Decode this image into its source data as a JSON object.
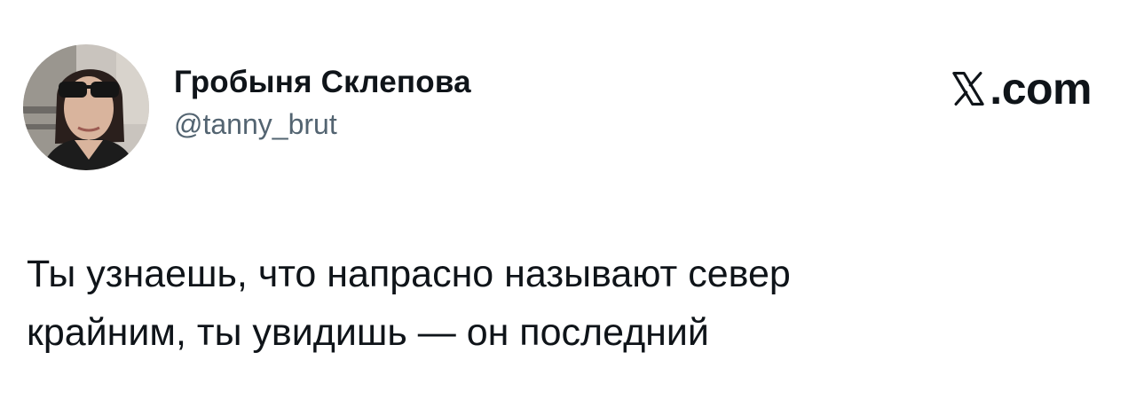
{
  "author": {
    "display_name": "Гробыня Склепова",
    "handle": "@tanny_brut",
    "avatar_icon": "profile-photo"
  },
  "brand": {
    "logo_icon": "x-logo-icon",
    "suffix": ".com"
  },
  "tweet": {
    "lines": [
      "Ты узнаешь, что напрасно называют север",
      "крайним, ты увидишь — он последний"
    ]
  },
  "colors": {
    "text": "#0f1419",
    "secondary_text": "#536471",
    "background": "#ffffff"
  }
}
